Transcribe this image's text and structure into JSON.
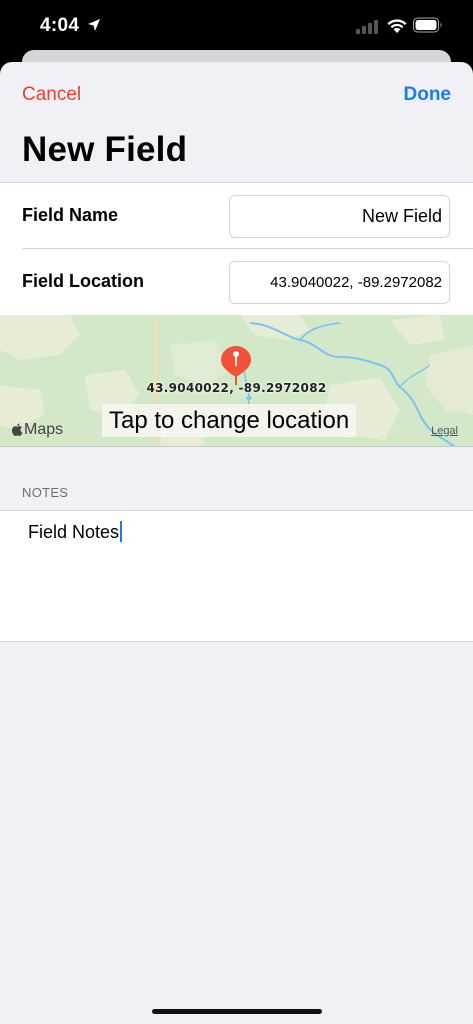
{
  "status_bar": {
    "time": "4:04",
    "icons": [
      "location-arrow-icon",
      "cellular-signal-icon",
      "wifi-icon",
      "battery-icon"
    ]
  },
  "nav": {
    "cancel_label": "Cancel",
    "done_label": "Done",
    "title": "New Field"
  },
  "form": {
    "name_label": "Field Name",
    "name_value": "New Field",
    "location_label": "Field Location",
    "location_value": "43.9040022, -89.2972082"
  },
  "map": {
    "pin_coords": "43.9040022, -89.2972082",
    "tap_hint": "Tap to change location",
    "maps_brand": "Maps",
    "legal_label": "Legal"
  },
  "notes": {
    "header": "NOTES",
    "text": "Field Notes"
  },
  "colors": {
    "cancel": "#e8412a",
    "done": "#1a7cf4",
    "pin": "#f0523a",
    "map_land": "#d2e8c8",
    "map_water": "#7cc3f0",
    "background": "#f1f0f6"
  }
}
